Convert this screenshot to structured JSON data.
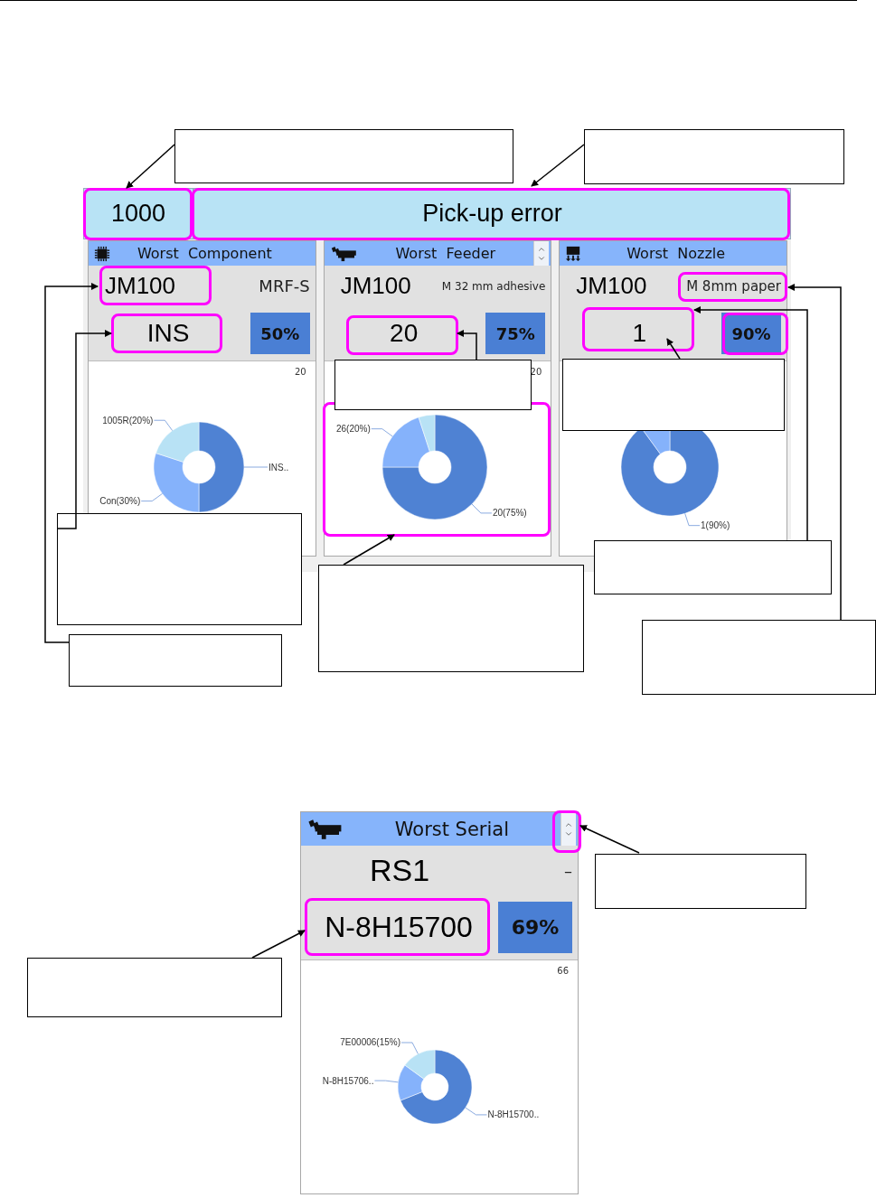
{
  "header": {
    "code": "1000",
    "title": "Pick-up error"
  },
  "panels": [
    {
      "kind": "chip",
      "title": "Worst  Component",
      "scroller": false,
      "model": "JM100",
      "detail": "MRF-S",
      "value": "INS",
      "percent": "50%",
      "count": "20",
      "chart_data": {
        "type": "donut",
        "categories": [
          "INS..",
          "Con(30%)",
          "1005R(20%)"
        ],
        "values": [
          50,
          30,
          20
        ]
      }
    },
    {
      "kind": "feeder",
      "title": "Worst  Feeder",
      "scroller": true,
      "model": "JM100",
      "detail": "M 32 mm adhesive",
      "value": "20",
      "percent": "75%",
      "count": "20",
      "chart_data": {
        "type": "donut",
        "categories": [
          "20(75%)",
          "26(20%)",
          null
        ],
        "values": [
          75,
          20,
          5
        ]
      }
    },
    {
      "kind": "nozzle",
      "title": "Worst  Nozzle",
      "scroller": false,
      "model": "JM100",
      "detail": "M 8mm paper",
      "value": "1",
      "percent": "90%",
      "chart_data": {
        "type": "donut",
        "categories": [
          "1(90%)",
          null
        ],
        "values": [
          90,
          10
        ]
      }
    }
  ],
  "serial_panel": {
    "kind": "feeder",
    "title": "Worst Serial",
    "scroller": true,
    "model": "RS1",
    "detail": "–",
    "value": "N-8H15700",
    "percent": "69%",
    "count": "66",
    "chart_data": {
      "type": "donut",
      "categories": [
        "N-8H15700..",
        "N-8H15706..",
        "7E00006(15%)"
      ],
      "values": [
        69,
        16,
        15
      ]
    }
  }
}
